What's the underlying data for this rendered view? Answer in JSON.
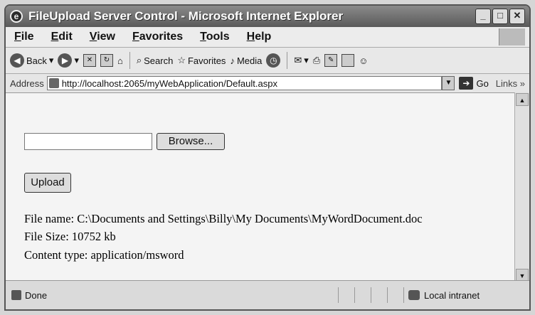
{
  "window": {
    "title": "FileUpload Server Control - Microsoft Internet Explorer",
    "controls": [
      "_",
      "□",
      "✕"
    ]
  },
  "menu": [
    {
      "key": "F",
      "rest": "ile"
    },
    {
      "key": "E",
      "rest": "dit"
    },
    {
      "key": "V",
      "rest": "iew"
    },
    {
      "key": "F",
      "rest": "avorites",
      "prefix": ""
    },
    {
      "key": "T",
      "rest": "ools"
    },
    {
      "key": "H",
      "rest": "elp"
    }
  ],
  "toolbar": {
    "back": "Back",
    "search": "Search",
    "favorites": "Favorites",
    "media": "Media"
  },
  "address": {
    "label": "Address",
    "url": "http://localhost:2065/myWebApplication/Default.aspx",
    "go": "Go",
    "links": "Links"
  },
  "page": {
    "browse_label": "Browse...",
    "upload_label": "Upload",
    "file_name": "File name: C:\\Documents and Settings\\Billy\\My Documents\\MyWordDocument.doc",
    "file_size": "File Size: 10752 kb",
    "content_type": "Content type: application/msword"
  },
  "status": {
    "text": "Done",
    "zone": "Local intranet"
  }
}
